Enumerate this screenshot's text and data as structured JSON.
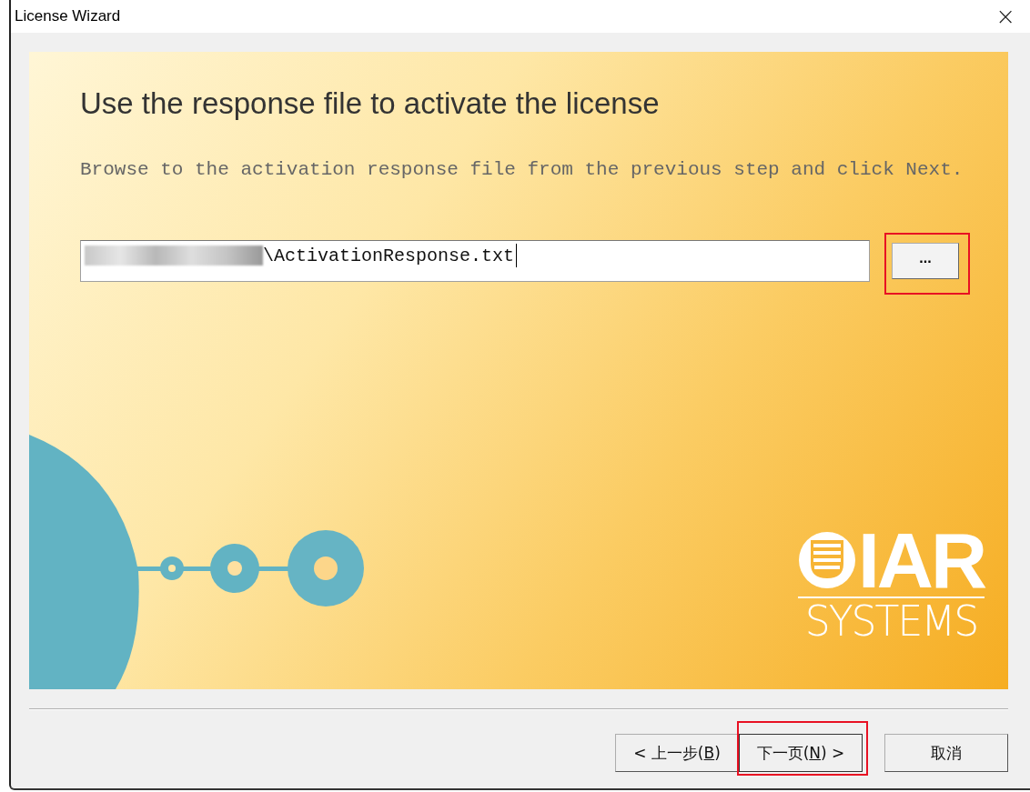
{
  "window": {
    "title": "License Wizard",
    "close": "×"
  },
  "page": {
    "heading": "Use the response file to activate the license",
    "instruction": "Browse to the activation response file from the previous step and click Next."
  },
  "file_field": {
    "value": "\\ActivationResponse.txt",
    "redacted_prefix": true,
    "focused": true
  },
  "browse_button": {
    "label": "...",
    "highlighted": true
  },
  "logo": {
    "name": "IAR",
    "subtitle": "SYSTEMS"
  },
  "buttons": [
    {
      "label": "< 上一步(",
      "access_key": "B",
      "label_end": ")",
      "highlighted": false,
      "default": false
    },
    {
      "label": "下一页(",
      "access_key": "N",
      "label_end": ") >",
      "highlighted": true,
      "default": true
    },
    {
      "label": "取消",
      "highlighted": false,
      "default": false
    }
  ]
}
